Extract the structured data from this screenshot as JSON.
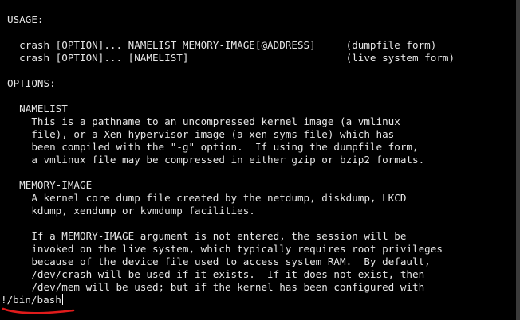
{
  "terminal": {
    "lines": [
      "USAGE:",
      "",
      "  crash [OPTION]... NAMELIST MEMORY-IMAGE[@ADDRESS]     (dumpfile form)",
      "  crash [OPTION]... [NAMELIST]                          (live system form)",
      "",
      "OPTIONS:",
      "",
      "  NAMELIST",
      "    This is a pathname to an uncompressed kernel image (a vmlinux",
      "    file), or a Xen hypervisor image (a xen-syms file) which has",
      "    been compiled with the \"-g\" option.  If using the dumpfile form,",
      "    a vmlinux file may be compressed in either gzip or bzip2 formats.",
      "",
      "  MEMORY-IMAGE",
      "    A kernel core dump file created by the netdump, diskdump, LKCD",
      "    kdump, xendump or kvmdump facilities.",
      "",
      "    If a MEMORY-IMAGE argument is not entered, the session will be",
      "    invoked on the live system, which typically requires root privileges",
      "    because of the device file used to access system RAM.  By default,",
      "    /dev/crash will be used if it exists.  If it does not exist, then",
      "    /dev/mem will be used; but if the kernel has been configured with"
    ],
    "prompt_input": "!/bin/bash"
  },
  "colors": {
    "background": "#000000",
    "text": "#e6e6e6",
    "annotation_underline": "#e01b1b"
  },
  "icons": {
    "annotation": "red-underline-mark"
  }
}
